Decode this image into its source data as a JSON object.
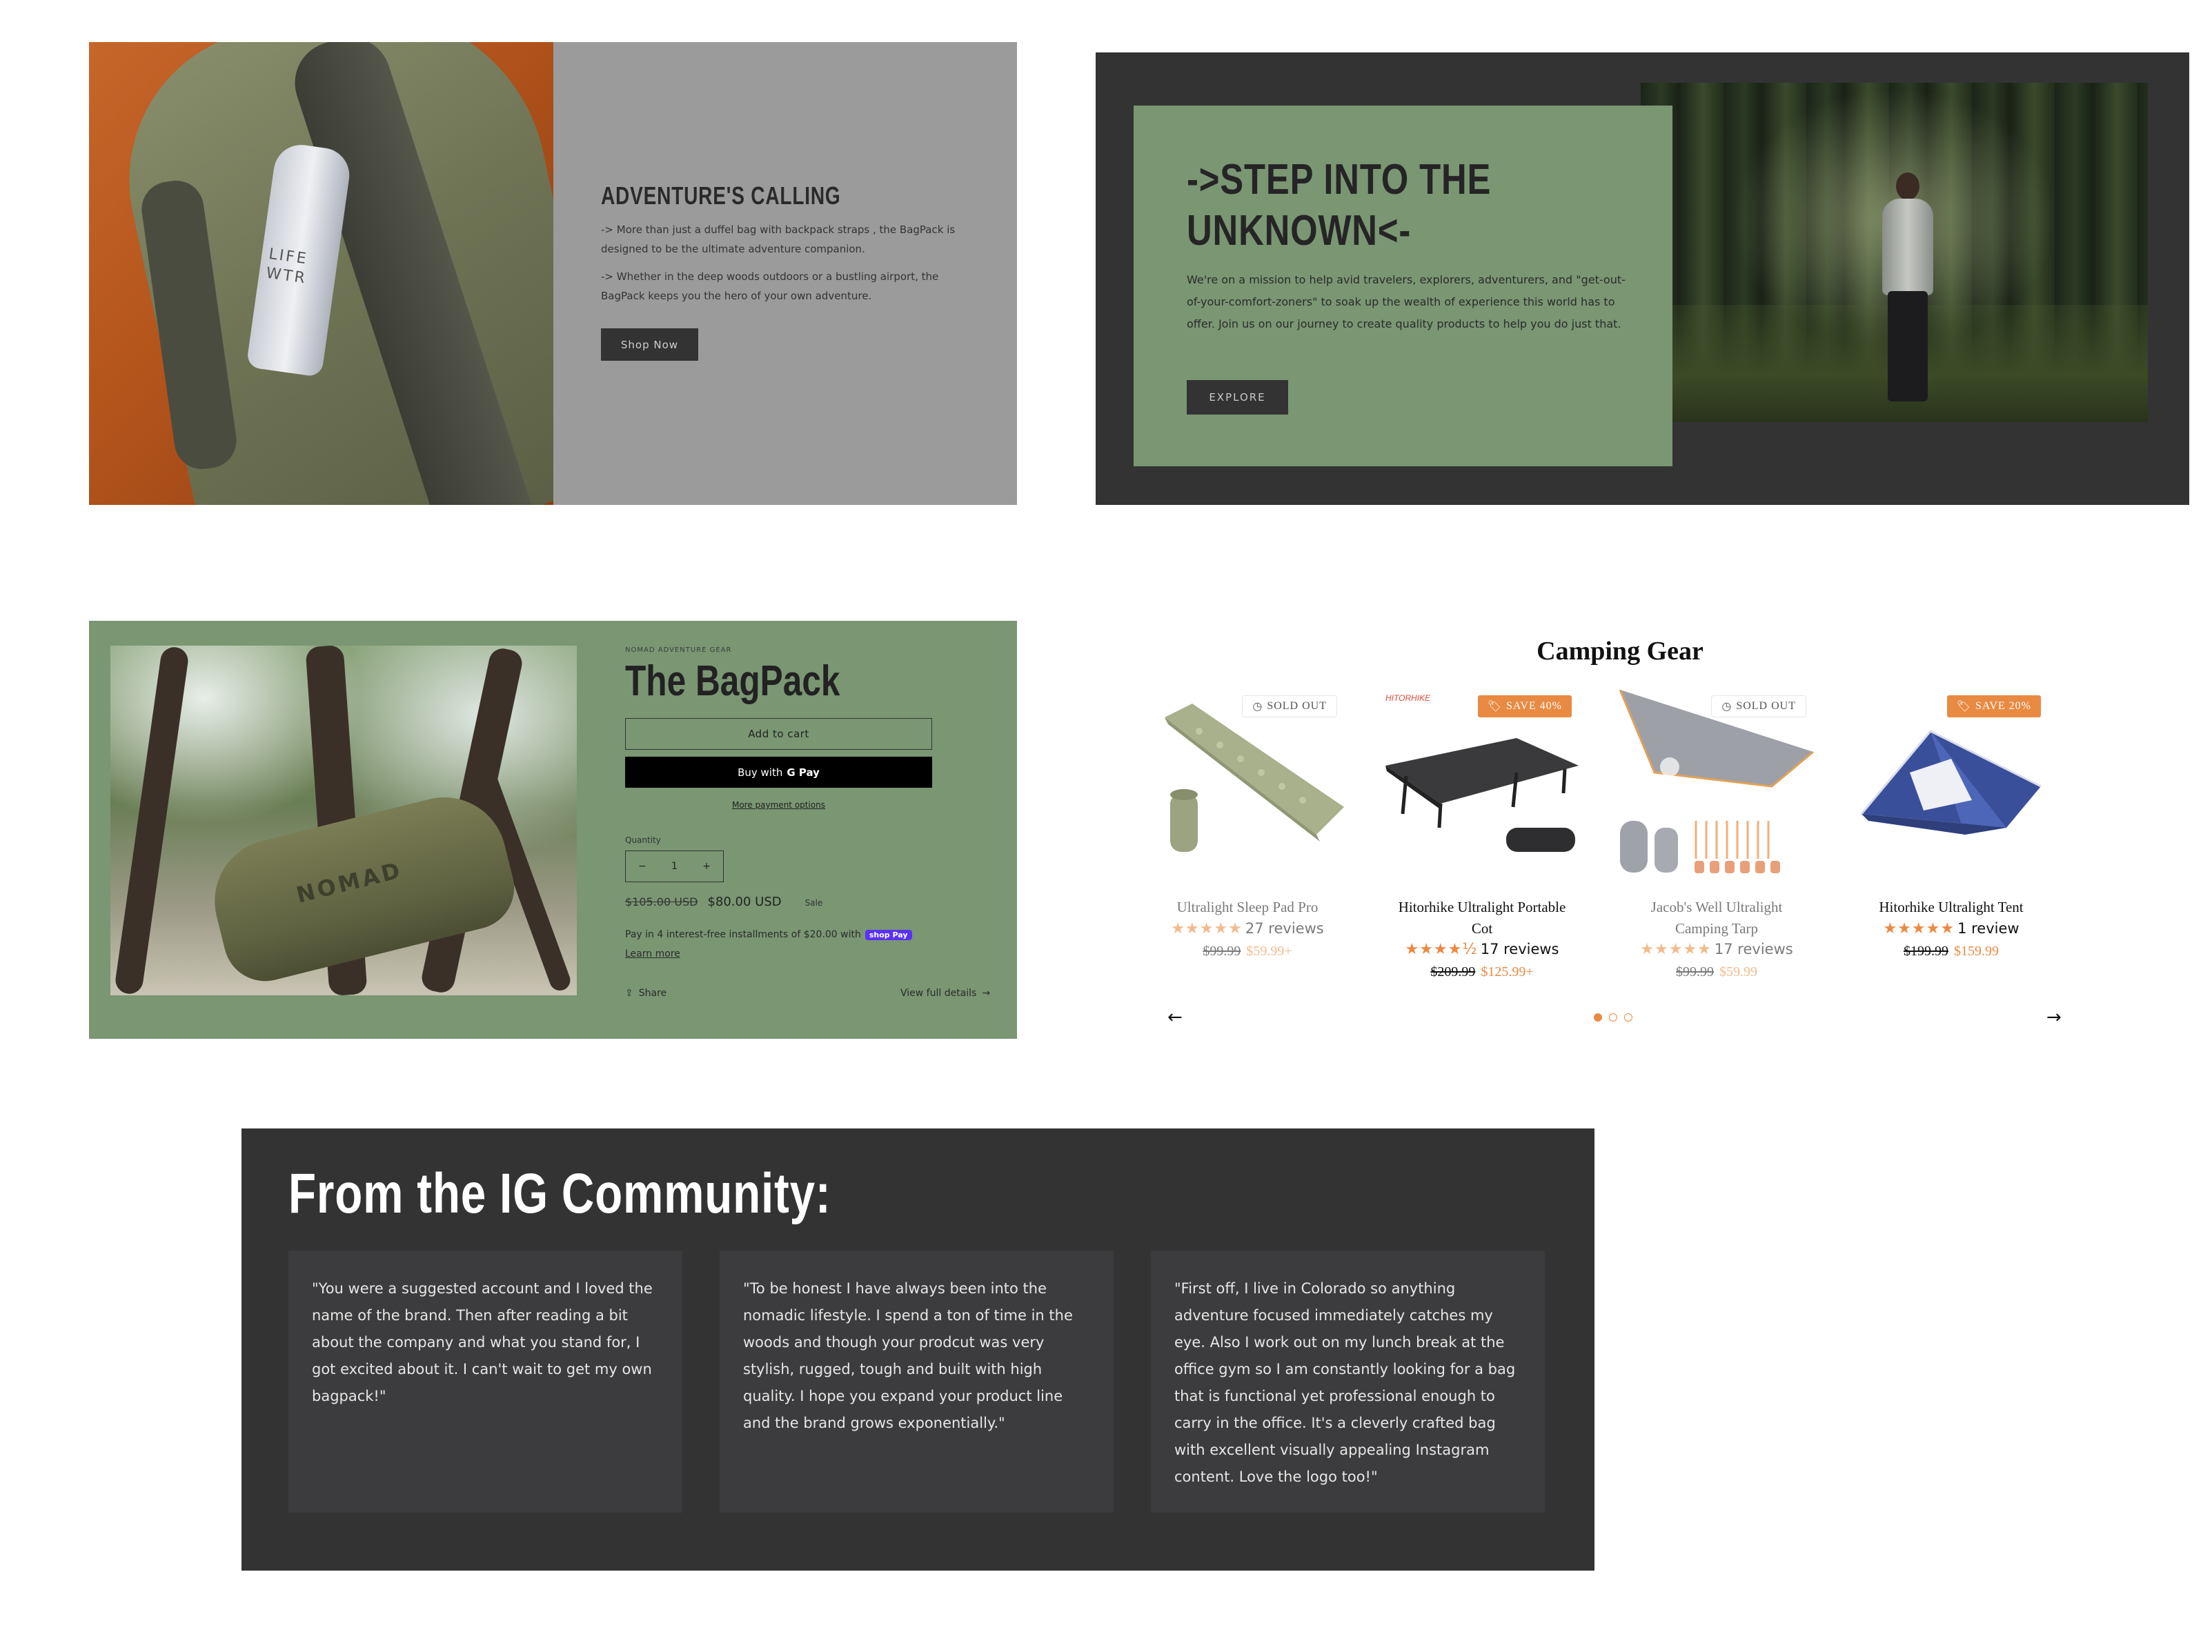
{
  "adventure": {
    "title": "ADVENTURE'S CALLING",
    "bottle_text": "LIFE WTR",
    "para1": "-> More than just a duffel bag with backpack straps , the BagPack is designed to be the ultimate adventure companion.",
    "para2": "-> Whether in the deep woods outdoors or a bustling airport, the BagPack keeps you the hero of your own adventure.",
    "button": "Shop Now"
  },
  "unknown": {
    "title_line1": "->STEP INTO THE",
    "title_line2": "UNKNOWN<-",
    "para": "We're on a mission to help avid travelers, explorers, adventurers, and \"get-out-of-your-comfort-zoners\" to soak up the wealth of experience this world has to offer. Join us on our journey to create quality products to help you do just that.",
    "button": "EXPLORE"
  },
  "product": {
    "vendor": "NOMAD ADVENTURE GEAR",
    "title": "The BagPack",
    "bag_text": "NOMAD",
    "add_to_cart": "Add to cart",
    "buy_with": "Buy with",
    "gpay": "G Pay",
    "more_options": "More payment options",
    "quantity_label": "Quantity",
    "quantity": "1",
    "minus": "−",
    "plus": "+",
    "compare_price": "$105.00 USD",
    "price": "$80.00 USD",
    "sale_label": "Sale",
    "installments": "Pay in 4 interest-free installments of $20.00 with",
    "shop_pay": "shop Pay",
    "learn_more": "Learn more",
    "share": "Share",
    "view_details": "View full details"
  },
  "camping": {
    "heading": "Camping Gear",
    "cards": [
      {
        "name_line1": "Ultralight Sleep Pad Pro",
        "name_line2": "",
        "stars": "★★★★★",
        "reviews": "27 reviews",
        "old_price": "$99.99",
        "new_price": "$59.99+",
        "badge": "SOLD OUT",
        "badge_type": "sold"
      },
      {
        "name_line1": "Hitorhike Ultralight Portable",
        "name_line2": "Cot",
        "stars": "★★★★½",
        "reviews": "17 reviews",
        "old_price": "$209.99",
        "new_price": "$125.99+",
        "badge": "SAVE 40%",
        "badge_type": "save",
        "brand": "HITORHIKE"
      },
      {
        "name_line1": "Jacob's Well Ultralight",
        "name_line2": "Camping Tarp",
        "stars": "★★★★★",
        "reviews": "17 reviews",
        "old_price": "$99.99",
        "new_price": "$59.99",
        "badge": "SOLD OUT",
        "badge_type": "sold"
      },
      {
        "name_line1": "Hitorhike Ultralight Tent",
        "name_line2": "",
        "stars": "★★★★★",
        "reviews": "1 review",
        "old_price": "$199.99",
        "new_price": "$159.99",
        "badge": "SAVE 20%",
        "badge_type": "save"
      }
    ],
    "prev": "←",
    "next": "→"
  },
  "community": {
    "title": "From the IG Community:",
    "quotes": [
      "\"You were a suggested account and I loved the name of the brand. Then after reading a bit about the company and what you stand for, I got excited about it. I can't wait to get my own bagpack!\"",
      "\"To be honest I have always been into the nomadic lifestyle. I spend a ton of time in the woods and though your prodcut was very stylish, rugged, tough and built with high quality. I hope you expand your product line and the brand grows exponentially.\"",
      "\"First off, I live in Colorado so anything adventure focused immediately catches my eye. Also I work out on my lunch break at the office gym so I am constantly looking for a bag that is functional yet professional enough to carry in the office. It's a cleverly crafted bag with excellent visually appealing Instagram content. Love the logo too!\""
    ]
  },
  "colors": {
    "accent": "#e98a42",
    "sage": "#7a9673",
    "charcoal": "#333334",
    "gray_panel": "#9b9b9b"
  }
}
